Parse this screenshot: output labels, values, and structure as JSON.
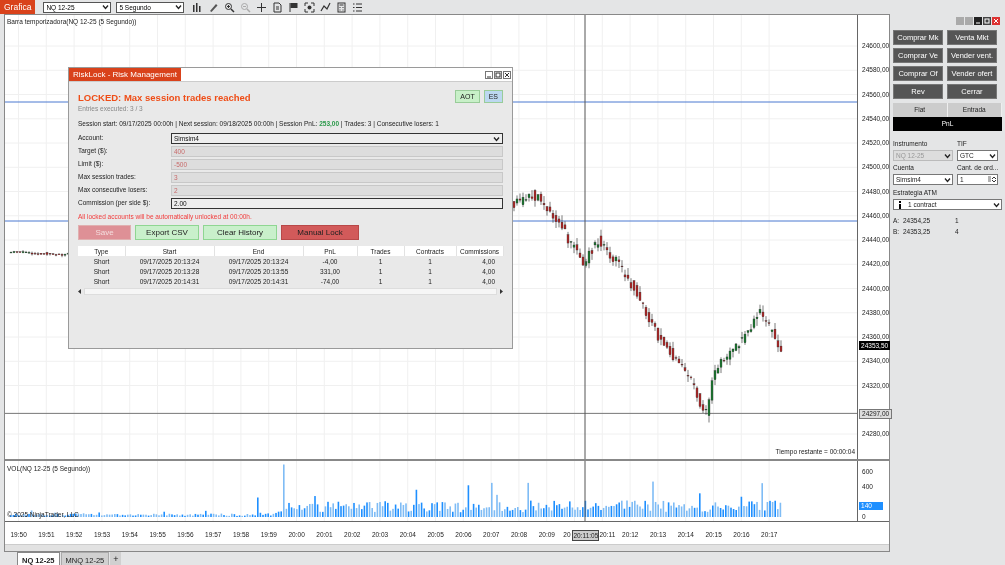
{
  "toolbar": {
    "tab": "Grafica",
    "instrument": "NQ 12-25",
    "interval": "5 Segundo"
  },
  "chart": {
    "title": "Barra temporizadora(NQ 12-25 (5 Segundo))",
    "price_ticks": [
      "24600,00",
      "24580,00",
      "24560,00",
      "24540,00",
      "24520,00",
      "24500,00",
      "24480,00",
      "24460,00",
      "24440,00",
      "24420,00",
      "24400,00",
      "24380,00",
      "24360,00",
      "24340,00",
      "24320,00",
      "24280,00"
    ],
    "last_price_tag": "24353,50",
    "line_price_tag": "24297,00",
    "time_remaining": "Tiempo restante = 00:00:04",
    "volume_title": "VOL(NQ 12-25 (5 Segundo))",
    "volume_ticks": [
      "600",
      "400",
      "0"
    ],
    "volume_tag": "140",
    "copyright": "© 2025 NinjaTrader, LLC",
    "time_labels": [
      "19:50",
      "19:51",
      "19:52",
      "19:53",
      "19:54",
      "19:55",
      "19:56",
      "19:57",
      "19:58",
      "19:59",
      "20:00",
      "20:01",
      "20:02",
      "20:03",
      "20:04",
      "20:05",
      "20:06",
      "20:07",
      "20:08",
      "20:09",
      "20",
      "20:11",
      "20:12",
      "20:13",
      "20:14",
      "20:15",
      "20:16",
      "20:17"
    ],
    "crosshair_time": "20:11:05"
  },
  "tabs": [
    {
      "label": "NQ 12-25",
      "selected": true
    },
    {
      "label": "MNQ 12-25",
      "selected": false
    }
  ],
  "add_tab": "+",
  "order_panel": {
    "buttons": [
      "Comprar Mk",
      "Venta Mkt",
      "Comprar Ve",
      "Vender vent.",
      "Comprar Of",
      "Vender ofert",
      "Rev",
      "Cerrar"
    ],
    "position_cells": [
      "Flat",
      "Entrada"
    ],
    "pnl": "PnL",
    "fields": [
      {
        "label": "Instrumento",
        "value": "NQ 12-25",
        "kind": "select",
        "disabled": true
      },
      {
        "label": "TIF",
        "value": "GTC",
        "kind": "select",
        "disabled": false
      },
      {
        "label": "Cuenta",
        "value": "Simsim4",
        "kind": "select",
        "disabled": false
      },
      {
        "label": "Cant. de ord...",
        "value": "1",
        "kind": "spinner",
        "disabled": false
      }
    ],
    "atm_label": "Estrategia ATM",
    "atm_value": "1 contract",
    "quotes": [
      {
        "label": "A:",
        "price": "24354,25",
        "size": "1"
      },
      {
        "label": "B:",
        "price": "24353,25",
        "size": "4"
      }
    ]
  },
  "dialog": {
    "title": "RiskLock - Risk Management",
    "status": "LOCKED: Max session trades reached",
    "entries": "Entries executed: 3 / 3",
    "badges": [
      {
        "label": "AOT",
        "color": "#c8f0c8"
      },
      {
        "label": "ES",
        "color": "#bcd8f0"
      }
    ],
    "session_info": "Session start: 09/17/2025 00:00h | Next session: 09/18/2025 00:00h | Session PnL: **253,00** | Trades: 3 | Consecutive losers: 1",
    "fields": [
      {
        "label": "Account:",
        "value": "Simsim4",
        "kind": "select",
        "disabled": false
      },
      {
        "label": "Target ($):",
        "value": "400",
        "kind": "text",
        "disabled": true
      },
      {
        "label": "Limit ($):",
        "value": "-500",
        "kind": "text",
        "disabled": true
      },
      {
        "label": "Max session trades:",
        "value": "3",
        "kind": "text",
        "disabled": true
      },
      {
        "label": "Max consecutive losers:",
        "value": "2",
        "kind": "text",
        "disabled": true
      },
      {
        "label": "Commission (per side $):",
        "value": "2.00",
        "kind": "text",
        "disabled": false
      }
    ],
    "notice": "All locked accounts will be automatically unlocked at 00:00h.",
    "buttons": [
      {
        "label": "Save",
        "kind": "danger",
        "disabled": true
      },
      {
        "label": "Export CSV",
        "kind": "success",
        "disabled": false
      },
      {
        "label": "Clear History",
        "kind": "success",
        "disabled": false
      },
      {
        "label": "Manual Lock",
        "kind": "danger",
        "disabled": false
      }
    ],
    "table": {
      "columns": [
        "Type",
        "Start",
        "End",
        "PnL",
        "Trades",
        "Contracts",
        "Commissions"
      ],
      "rows": [
        [
          "Short",
          "09/17/2025 20:13:24",
          "09/17/2025 20:13:24",
          "-4,00",
          "1",
          "1",
          "4,00"
        ],
        [
          "Short",
          "09/17/2025 20:13:28",
          "09/17/2025 20:13:55",
          "331,00",
          "1",
          "1",
          "4,00"
        ],
        [
          "Short",
          "09/17/2025 20:14:31",
          "09/17/2025 20:14:31",
          "-74,00",
          "1",
          "1",
          "4,00"
        ]
      ]
    }
  }
}
